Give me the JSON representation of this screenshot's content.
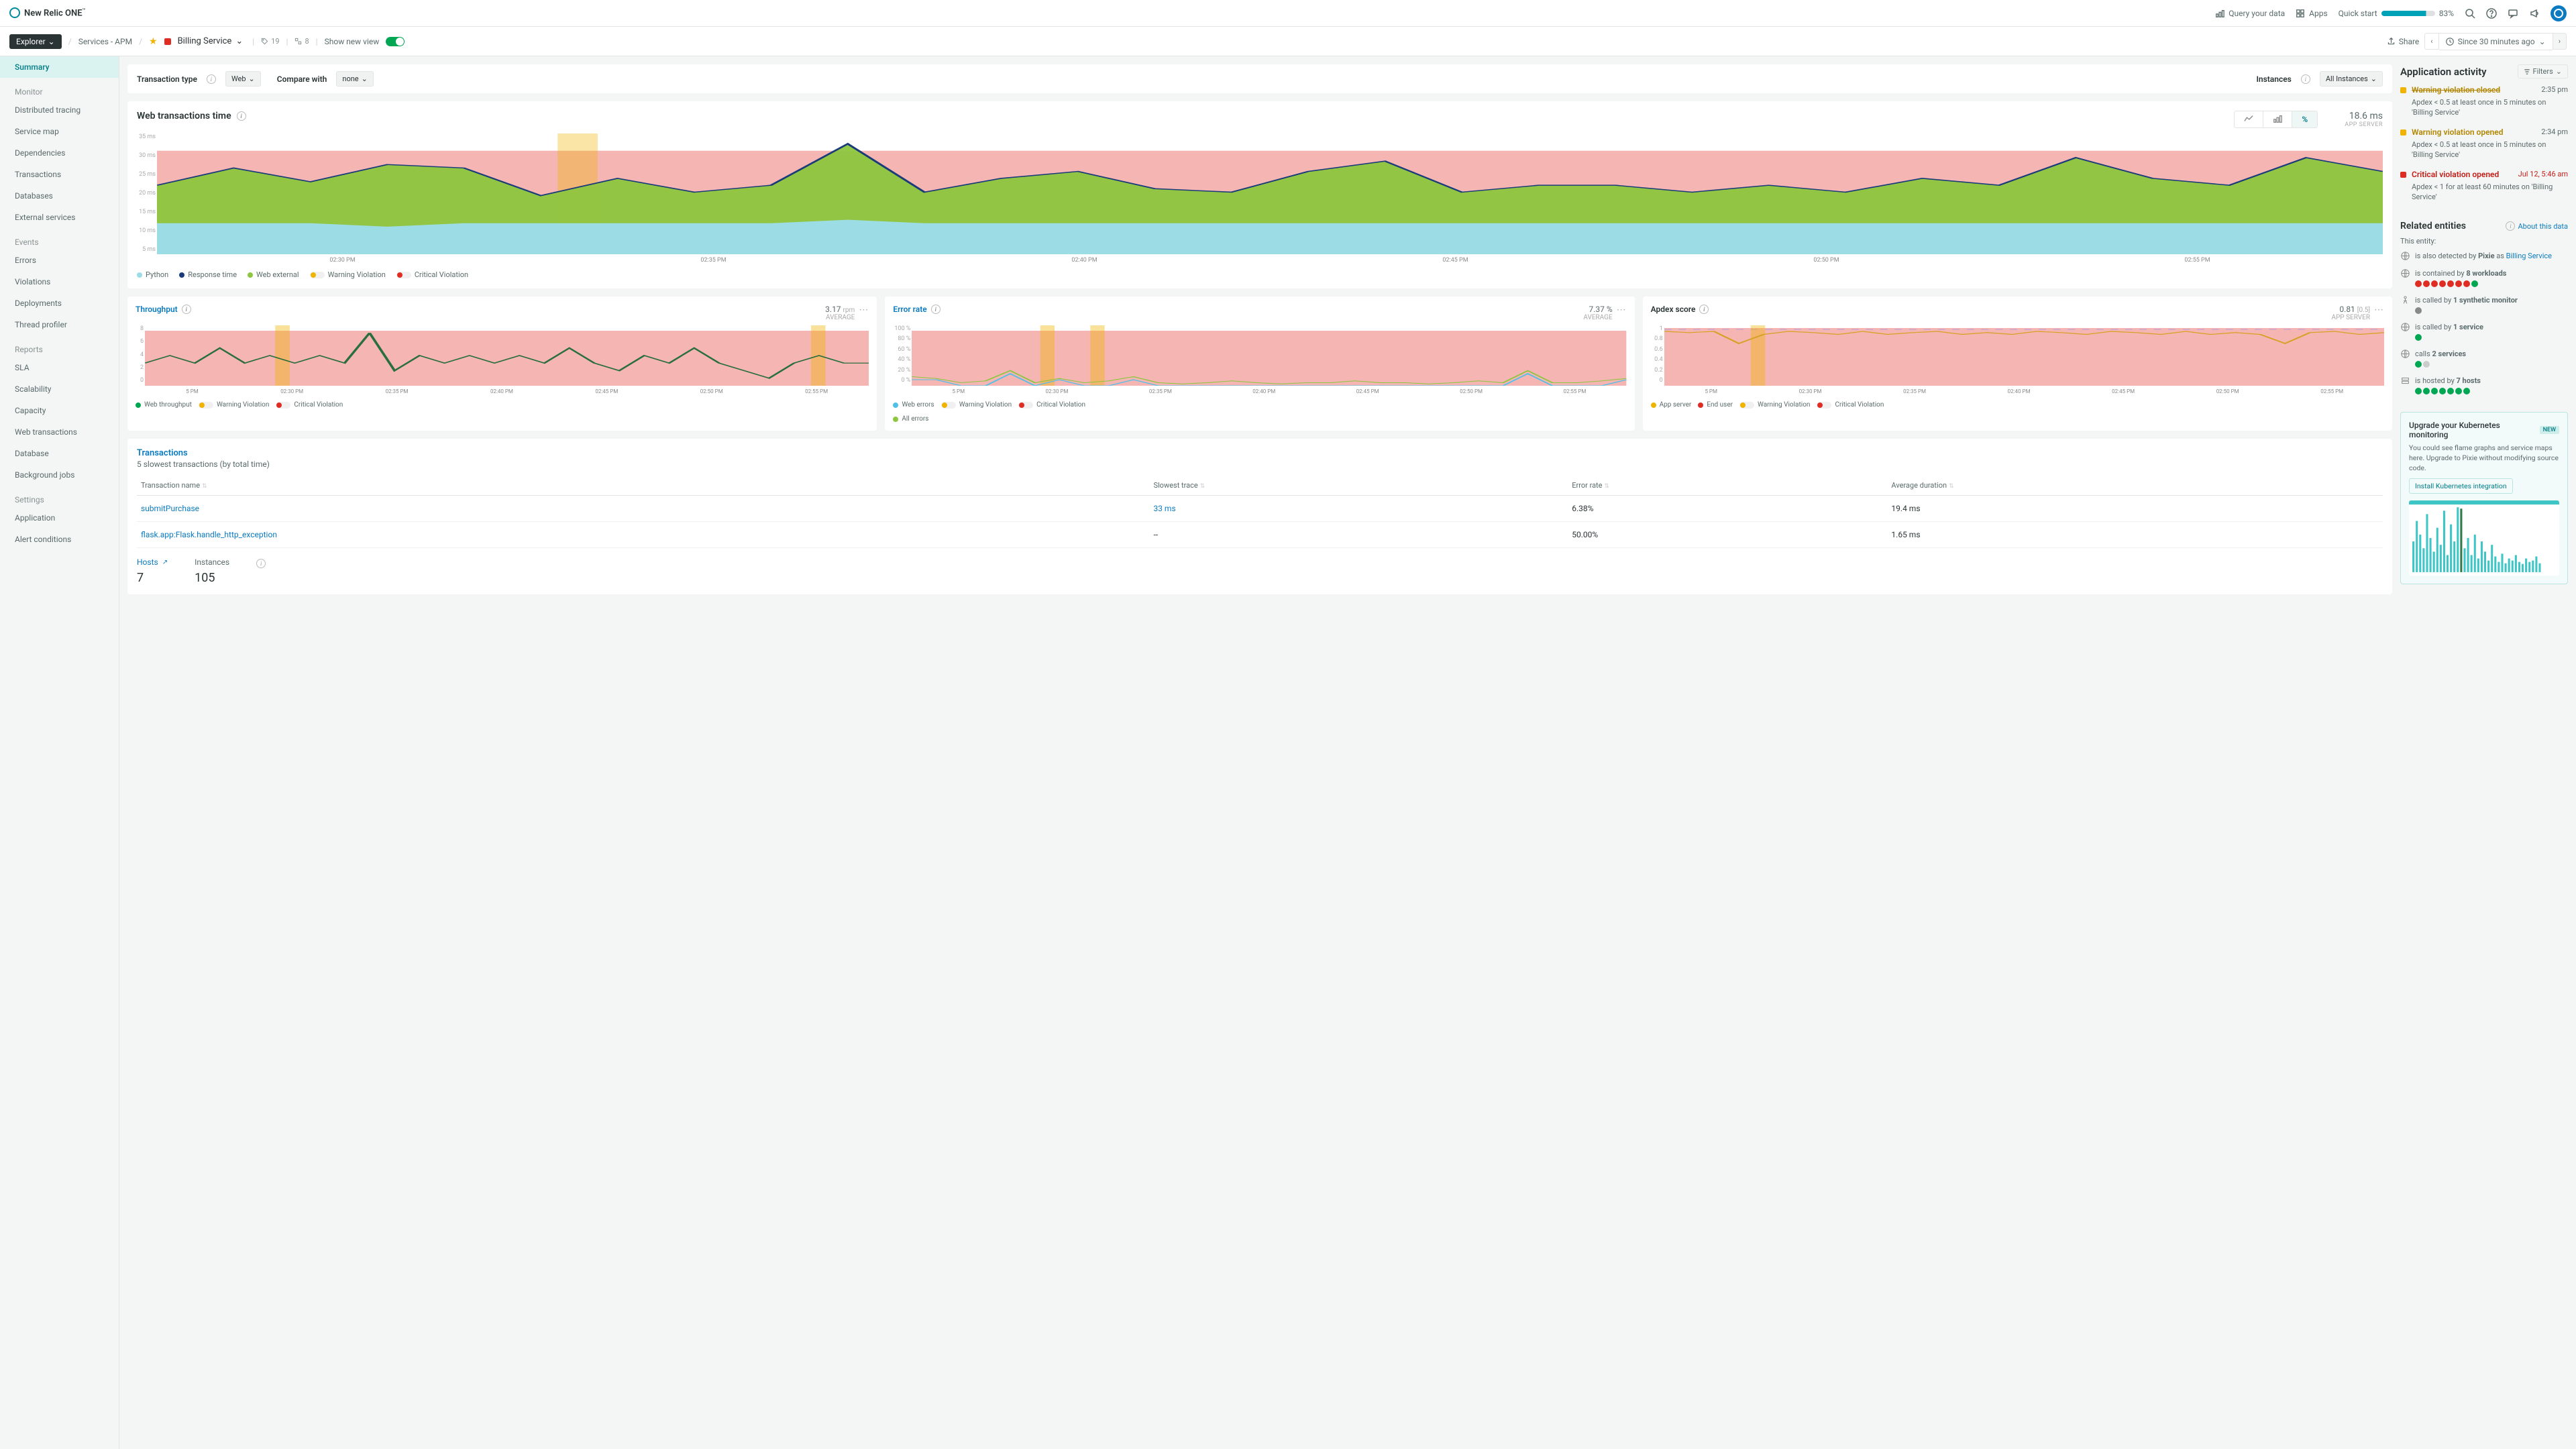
{
  "brand": "New Relic ONE",
  "topbar": {
    "query": "Query your data",
    "apps": "Apps",
    "quickstart": "Quick start",
    "quickstart_pct": "83%"
  },
  "breadcrumb": {
    "explorer": "Explorer",
    "services": "Services - APM",
    "current": "Billing Service",
    "count1": "19",
    "count2": "8",
    "show_new": "Show new view",
    "share": "Share",
    "time": "Since 30 minutes ago"
  },
  "sidebar": {
    "summary": "Summary",
    "monitor_h": "Monitor",
    "monitor": [
      "Distributed tracing",
      "Service map",
      "Dependencies",
      "Transactions",
      "Databases",
      "External services"
    ],
    "events_h": "Events",
    "events": [
      "Errors",
      "Violations",
      "Deployments",
      "Thread profiler"
    ],
    "reports_h": "Reports",
    "reports": [
      "SLA",
      "Scalability",
      "Capacity",
      "Web transactions",
      "Database",
      "Background jobs"
    ],
    "settings_h": "Settings",
    "settings": [
      "Application",
      "Alert conditions"
    ]
  },
  "filters": {
    "trans_type": "Transaction type",
    "trans_val": "Web",
    "compare": "Compare with",
    "compare_val": "none",
    "instances": "Instances",
    "instances_val": "All Instances"
  },
  "main_chart": {
    "title": "Web transactions time",
    "value": "18.6 ms",
    "sub": "APP SERVER",
    "btn_percent": "%",
    "legend": [
      "Python",
      "Response time",
      "Web external",
      "Warning Violation",
      "Critical Violation"
    ]
  },
  "mini": {
    "throughput": {
      "title": "Throughput",
      "val": "3.17",
      "unit": "rpm",
      "sub": "AVERAGE",
      "legend": [
        "Web throughput",
        "Warning Violation",
        "Critical Violation"
      ]
    },
    "error": {
      "title": "Error rate",
      "val": "7.37 %",
      "sub": "AVERAGE",
      "legend": [
        "Web errors",
        "Warning Violation",
        "Critical Violation",
        "All errors"
      ]
    },
    "apdex": {
      "title": "Apdex score",
      "val": "0.81",
      "unit": "[0.5]",
      "sub": "APP SERVER",
      "legend": [
        "App server",
        "End user",
        "Warning Violation",
        "Critical Violation"
      ]
    }
  },
  "transactions": {
    "title": "Transactions",
    "sub": "5 slowest transactions (by total time)",
    "cols": [
      "Transaction name",
      "Slowest trace",
      "Error rate",
      "Average duration"
    ],
    "rows": [
      {
        "name": "submitPurchase",
        "trace": "33 ms",
        "err": "6.38%",
        "avg": "19.4 ms"
      },
      {
        "name": "flask.app:Flask.handle_http_exception",
        "trace": "--",
        "err": "50.00%",
        "avg": "1.65 ms"
      }
    ]
  },
  "hosts": {
    "hosts_l": "Hosts",
    "hosts_v": "7",
    "inst_l": "Instances",
    "inst_v": "105"
  },
  "activity": {
    "title": "Application activity",
    "filters": "Filters",
    "items": [
      {
        "type": "warn",
        "closed": true,
        "title": "Warning violation closed",
        "time": "2:35 pm",
        "body": "Apdex < 0.5 at least once in 5 minutes on 'Billing Service'"
      },
      {
        "type": "warn",
        "closed": false,
        "title": "Warning violation opened",
        "time": "2:34 pm",
        "body": "Apdex < 0.5 at least once in 5 minutes on 'Billing Service'"
      },
      {
        "type": "crit",
        "closed": false,
        "title": "Critical violation opened",
        "time": "Jul 12, 5:46 am",
        "body": "Apdex < 1 for at least 60 minutes on 'Billing Service'"
      }
    ]
  },
  "related": {
    "title": "Related entities",
    "about": "About this data",
    "sub": "This entity:",
    "pixie_pre": "is also detected by ",
    "pixie_b": "Pixie",
    "pixie_as": " as ",
    "pixie_link": "Billing Service",
    "workloads_pre": "is contained by ",
    "workloads_b": "8 workloads",
    "synth_pre": "is called by ",
    "synth_b": "1 synthetic monitor",
    "service_pre": "is called by ",
    "service_b": "1 service",
    "calls_pre": "calls ",
    "calls_b": "2 services",
    "hosts_pre": "is hosted by ",
    "hosts_b": "7 hosts"
  },
  "upgrade": {
    "title": "Upgrade your Kubernetes monitoring",
    "new": "NEW",
    "body": "You could see flame graphs and service maps here. Upgrade to Pixie without modifying source code.",
    "btn": "Install Kubernetes integration"
  },
  "chart_data": {
    "web_transactions": {
      "type": "area",
      "x_labels": [
        "02:30 PM",
        "02:35 PM",
        "02:40 PM",
        "02:45 PM",
        "02:50 PM",
        "02:55 PM"
      ],
      "y_labels": [
        "35 ms",
        "30 ms",
        "25 ms",
        "20 ms",
        "15 ms",
        "10 ms",
        "5 ms"
      ],
      "ylim": [
        0,
        35
      ],
      "series": [
        {
          "name": "Python",
          "color": "#9cdde5",
          "values": [
            9,
            9,
            9,
            8,
            9,
            9,
            9,
            9,
            9,
            10,
            9,
            9,
            9,
            9,
            9,
            9,
            9,
            9,
            9,
            9,
            9,
            9,
            9,
            9,
            9,
            9,
            9,
            9,
            9,
            9
          ]
        },
        {
          "name": "Web external",
          "color": "#8dc63f",
          "values": [
            20,
            25,
            21,
            26,
            25,
            17,
            22,
            18,
            20,
            32,
            18,
            22,
            24,
            19,
            18,
            24,
            27,
            18,
            20,
            20,
            18,
            20,
            18,
            22,
            20,
            28,
            22,
            20,
            28,
            24
          ]
        }
      ],
      "response_time": {
        "color": "#1a3b7a",
        "values": [
          20,
          25,
          21,
          26,
          25,
          17,
          22,
          18,
          20,
          32,
          18,
          22,
          24,
          19,
          18,
          24,
          27,
          18,
          20,
          20,
          18,
          20,
          18,
          22,
          20,
          28,
          22,
          20,
          28,
          24
        ]
      },
      "critical_band": true,
      "warning_marker_x": 0.18
    },
    "throughput": {
      "type": "line",
      "ylim": [
        0,
        8
      ],
      "y_labels": [
        "8",
        "6",
        "4",
        "2",
        "0"
      ],
      "x_labels": [
        "5 PM",
        "02:30 PM",
        "02:35 PM",
        "02:40 PM",
        "02:45 PM",
        "02:50 PM",
        "02:55 PM"
      ],
      "values": [
        3,
        4,
        3,
        5,
        3,
        4,
        3,
        4,
        3,
        7,
        2,
        4,
        3,
        4,
        3,
        4,
        3,
        5,
        3,
        2,
        4,
        3,
        5,
        3,
        2,
        1,
        3,
        4,
        3,
        3
      ],
      "critical_band": true,
      "warning_markers": [
        0.18,
        0.92
      ]
    },
    "error_rate": {
      "type": "line",
      "ylim": [
        0,
        100
      ],
      "y_labels": [
        "100 %",
        "80 %",
        "60 %",
        "40 %",
        "20 %",
        "0 %"
      ],
      "x_labels": [
        "5 PM",
        "02:30 PM",
        "02:35 PM",
        "02:40 PM",
        "02:45 PM",
        "02:50 PM",
        "02:55 PM"
      ],
      "series": [
        {
          "name": "Web errors",
          "values": [
            10,
            10,
            0,
            0,
            20,
            0,
            10,
            0,
            0,
            10,
            0,
            0,
            0,
            0,
            0,
            0,
            0,
            0,
            0,
            0,
            0,
            0,
            0,
            0,
            0,
            20,
            0,
            0,
            0,
            10
          ]
        },
        {
          "name": "All errors",
          "values": [
            15,
            12,
            5,
            8,
            25,
            5,
            12,
            5,
            8,
            15,
            5,
            3,
            5,
            8,
            5,
            3,
            5,
            5,
            8,
            5,
            5,
            3,
            5,
            8,
            5,
            25,
            5,
            5,
            8,
            12
          ]
        }
      ],
      "critical_band": true,
      "warning_markers": [
        0.18,
        0.25
      ]
    },
    "apdex": {
      "type": "line",
      "ylim": [
        0,
        1
      ],
      "y_labels": [
        "1",
        "0.8",
        "0.6",
        "0.4",
        "0.2",
        "0"
      ],
      "x_labels": [
        "5 PM",
        "02:30 PM",
        "02:35 PM",
        "02:40 PM",
        "02:45 PM",
        "02:50 PM",
        "02:55 PM"
      ],
      "values": [
        0.9,
        0.88,
        0.9,
        0.7,
        0.85,
        0.9,
        0.88,
        0.85,
        0.9,
        0.85,
        0.88,
        0.9,
        0.85,
        0.88,
        0.85,
        0.9,
        0.88,
        0.85,
        0.9,
        0.88,
        0.85,
        0.9,
        0.85,
        0.88,
        0.85,
        0.7,
        0.88,
        0.9,
        0.85,
        0.88
      ],
      "critical_band": true,
      "warning_markers": [
        0.12
      ]
    }
  }
}
